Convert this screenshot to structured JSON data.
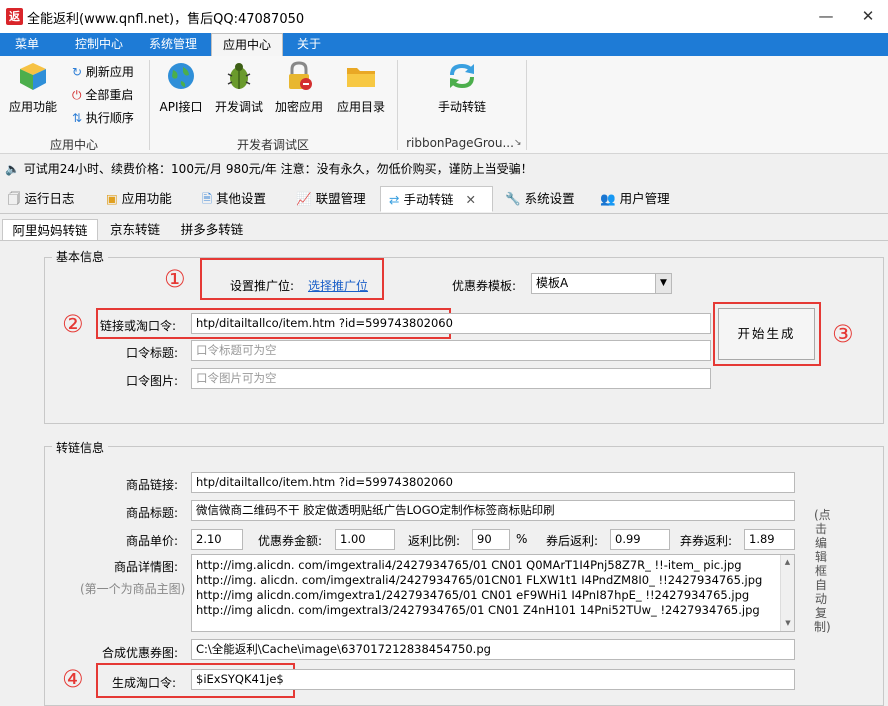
{
  "window": {
    "logo_char": "返",
    "title": "全能返利(www.qnfl.net)，售后QQ:47087050"
  },
  "ribbon_tabs": [
    "菜单",
    "控制中心",
    "系统管理",
    "应用中心",
    "关于"
  ],
  "ribbon": {
    "app_center": {
      "big_label": "应用功能",
      "small": [
        "刷新应用",
        "全部重启",
        "执行顺序"
      ],
      "group_label": "应用中心"
    },
    "dev": {
      "buttons": [
        "API接口",
        "开发调试",
        "加密应用",
        "应用目录"
      ],
      "group_label": "开发者调试区"
    },
    "page_group": {
      "button": "手动转链",
      "group_label": "ribbonPageGrou..."
    }
  },
  "notice": "可试用24小时、续费价格：100元/月  980元/年  注意：没有永久，勿低价购买，谨防上当受骗！",
  "doc_tabs": [
    "运行日志",
    "应用功能",
    "其他设置",
    "联盟管理",
    "手动转链",
    "系统设置",
    "用户管理"
  ],
  "sub_tabs": [
    "阿里妈妈转链",
    "京东转链",
    "拼多多转链"
  ],
  "basic": {
    "legend": "基本信息",
    "slot_label": "设置推广位:",
    "slot_link": "选择推广位",
    "coupon_label": "优惠券模板:",
    "coupon_value": "模板A",
    "link_label": "链接或淘口令:",
    "link_value": "htp/ditailtallco/item.htm ?id=599743802060",
    "title_label": "口令标题:",
    "title_placeholder": "口令标题可为空",
    "image_label": "口令图片:",
    "image_placeholder": "口令图片可为空",
    "generate_button": "开始生成"
  },
  "markers": [
    "①",
    "②",
    "③",
    "④"
  ],
  "convert": {
    "legend": "转链信息",
    "product_link_label": "商品链接:",
    "product_link_value": "htp/ditailtallco/item.htm ?id=599743802060",
    "product_title_label": "商品标题:",
    "product_title_value": "微信微商二维码不干 胶定做透明贴纸广告LOGO定制作标签商标贴印刷",
    "price_label": "商品单价:",
    "price_value": "2.10",
    "coupon_amount_label": "优惠券金额:",
    "coupon_amount_value": "1.00",
    "rebate_ratio_label": "返利比例:",
    "rebate_ratio_value": "90",
    "rebate_ratio_unit": "%",
    "after_coupon_label": "券后返利:",
    "after_coupon_value": "0.99",
    "abandon_label": "弃券返利:",
    "abandon_value": "1.89",
    "detail_label": "商品详情图:",
    "detail_hint": "(第一个为商品主图)",
    "detail_lines": [
      "http://img.alicdn. com/imgextrali4/2427934765/01 CN01 Q0MArT1I4Pnj58Z7R_ !!-item_ pic.jpg",
      "http://img. alicdn. com/imgextrali4/2427934765/01CN01 FLXW1t1 I4PndZM8I0_ !!2427934765.jpg",
      "http://img alicdn.com/imgextra1/2427934765/01 CN01 eF9WHi1 I4PnI87hpE_ !!2427934765.jpg",
      "http://img alicdn. com/imgextral3/2427934765/01 CN01 Z4nH101 14Pni52TUw_ !2427934765.jpg"
    ],
    "composite_label": "合成优惠券图:",
    "composite_value": "C:\\全能返利\\Cache\\image\\637017212838454750.pg",
    "kouling_label": "生成淘口令:",
    "kouling_value": "$iExSYQK41je$",
    "side_hint": "(点击编辑框自动复制)"
  }
}
